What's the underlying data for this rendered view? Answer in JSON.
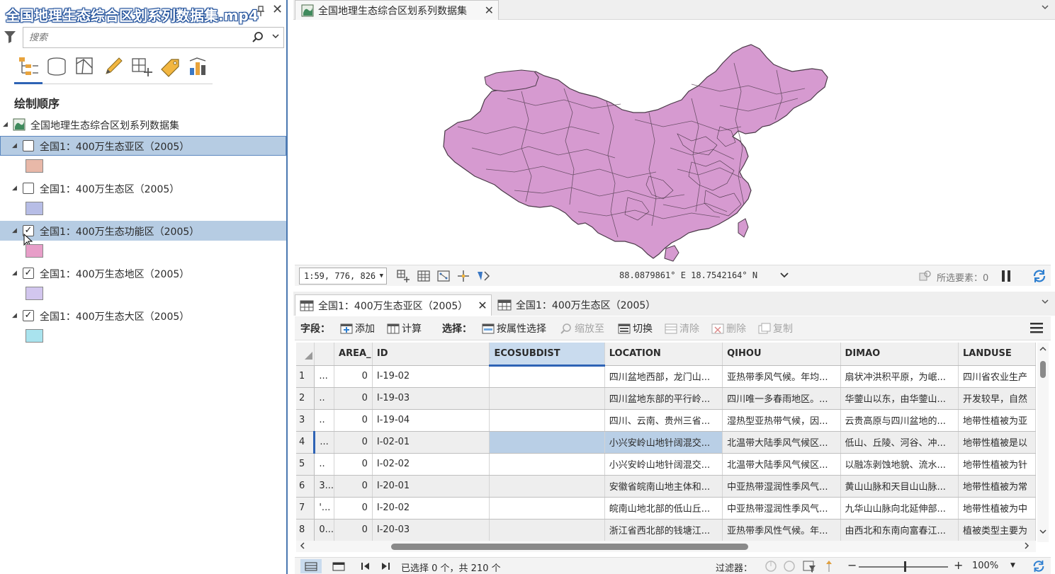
{
  "window_title": "全国地理生态综合区划系列数据集.mp4",
  "contents_pane": {
    "search_placeholder": "搜索",
    "section_title": "绘制顺序",
    "map_name": "全国地理生态综合区划系列数据集",
    "layers": [
      {
        "label": "全国1：400万生态亚区（2005）",
        "checked": false,
        "swatch": "#e8b8a8"
      },
      {
        "label": "全国1：400万生态区（2005）",
        "checked": false,
        "swatch": "#b7bde6"
      },
      {
        "label": "全国1：400万生态功能区（2005）",
        "checked": true,
        "swatch": "#e79ec8"
      },
      {
        "label": "全国1：400万生态地区（2005）",
        "checked": true,
        "swatch": "#d2c6ee"
      },
      {
        "label": "全国1：400万生态大区（2005）",
        "checked": true,
        "swatch": "#a9e3ee"
      }
    ]
  },
  "map_view": {
    "tab_label": "全国地理生态综合区划系列数据集",
    "scale": "1:59, 776, 826",
    "coordinates": "88.0879861° E 18.7542164° N",
    "selected_features": "所选要素：0",
    "fill_color": "#d69ad0"
  },
  "table_view": {
    "tabs": [
      "全国1：400万生态亚区（2005）",
      "全国1：400万生态区（2005）"
    ],
    "toolbar": {
      "fields_label": "字段：",
      "add": "添加",
      "calculate": "计算",
      "selection_label": "选择：",
      "select_by_attr": "按属性选择",
      "zoom_to": "缩放至",
      "switch": "切换",
      "clear": "清除",
      "delete": "删除",
      "copy": "复制"
    },
    "columns": [
      "",
      "AREA_",
      "ID",
      "ECOSUBDIST",
      "LOCATION",
      "QIHOU",
      "DIMAO",
      "LANDUSE"
    ],
    "rows": [
      {
        "n": "1",
        "c0": "...",
        "area": "0",
        "id": "I-19-02",
        "eco": "",
        "loc": "四川盆地西部，龙门山...",
        "qihou": "亚热带季风气候。年均...",
        "dimao": "扇状冲洪积平原，为岷...",
        "landuse": "四川省农业生产"
      },
      {
        "n": "2",
        "c0": "..",
        "area": "0",
        "id": "I-19-03",
        "eco": "",
        "loc": "四川盆地东部的平行岭...",
        "qihou": "四川唯一多春雨地区。...",
        "dimao": "华蓥山以东，由华蓥山...",
        "landuse": "开发较早，自然"
      },
      {
        "n": "3",
        "c0": "..",
        "area": "0",
        "id": "I-19-04",
        "eco": "",
        "loc": "四川、云南、贵州三省...",
        "qihou": "湿热型亚热带气候，因...",
        "dimao": "云贵高原与四川盆地的...",
        "landuse": "地带性植被为亚"
      },
      {
        "n": "4",
        "c0": "...",
        "area": "0",
        "id": "I-02-01",
        "eco": "",
        "loc": "小兴安岭山地针阔混交...",
        "qihou": "北温带大陆季风气候区...",
        "dimao": "低山、丘陵、河谷、冲...",
        "landuse": "地带性植被是以"
      },
      {
        "n": "5",
        "c0": "..",
        "area": "0",
        "id": "I-02-02",
        "eco": "",
        "loc": "小兴安岭山地针阔混交...",
        "qihou": "北温带大陆季风气候区...",
        "dimao": "以融冻剥蚀地貌、流水...",
        "landuse": "地带性植被为针"
      },
      {
        "n": "6",
        "c0": "3...",
        "area": "0",
        "id": "I-20-01",
        "eco": "",
        "loc": "安徽省皖南山地主体和...",
        "qihou": "中亚热带湿润性季风气...",
        "dimao": "黄山山脉和天目山山脉...",
        "landuse": "地带性植被为常"
      },
      {
        "n": "7",
        "c0": "'...",
        "area": "0",
        "id": "I-20-02",
        "eco": "",
        "loc": "皖南山地北部的低山丘...",
        "qihou": "中亚热带湿润性季风气...",
        "dimao": "九华山山脉向北延伸部...",
        "landuse": "地带性植被为中"
      },
      {
        "n": "8",
        "c0": "0...",
        "area": "0",
        "id": "I-20-03",
        "eco": "",
        "loc": "浙江省西北部的钱塘江...",
        "qihou": "亚热带季风性气候。年...",
        "dimao": "由西北和东南向富春江...",
        "landuse": "植被类型主要为"
      }
    ],
    "status": {
      "selection_text": "已选择 0 个，共 210 个",
      "filter_label": "过滤器：",
      "zoom": "100%"
    }
  }
}
